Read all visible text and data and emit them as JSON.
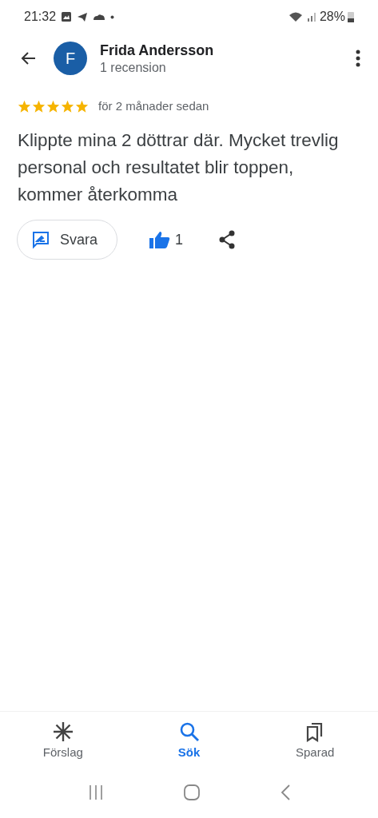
{
  "status_bar": {
    "time": "21:32",
    "battery": "28%"
  },
  "header": {
    "avatar_letter": "F",
    "name": "Frida Andersson",
    "subtitle": "1 recension"
  },
  "review": {
    "stars": 5,
    "date": "för 2 månader sedan",
    "text": "Klippte mina 2 döttrar där. Mycket trevlig personal och resultatet blir toppen, kommer återkomma"
  },
  "actions": {
    "reply": "Svara",
    "likes": "1"
  },
  "bottom_nav": [
    {
      "kind": "suggestions",
      "label": "Förslag",
      "selected": false
    },
    {
      "kind": "search",
      "label": "Sök",
      "selected": true
    },
    {
      "kind": "saved",
      "label": "Sparad",
      "selected": false
    }
  ]
}
